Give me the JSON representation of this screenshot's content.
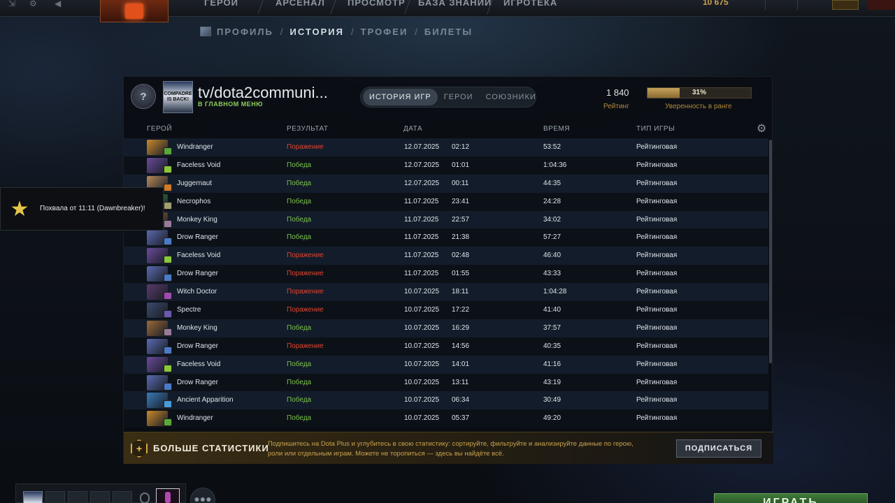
{
  "topbar": {
    "nav": [
      "ГЕРОИ",
      "АРСЕНАЛ",
      "ПРОСМОТР",
      "БАЗА ЗНАНИЙ",
      "ИГРОТЕКА"
    ],
    "currency": "10 675"
  },
  "subnav": {
    "items": [
      {
        "label": "ПРОФИЛЬ",
        "active": false
      },
      {
        "label": "ИСТОРИЯ",
        "active": true
      },
      {
        "label": "ТРОФЕИ",
        "active": false
      },
      {
        "label": "БИЛЕТЫ",
        "active": false
      }
    ]
  },
  "profile": {
    "avatar_text": "COMPADRE IS BACK!",
    "name": "tv/dota2communi...",
    "status": "В ГЛАВНОМ МЕНЮ",
    "tabs": [
      {
        "label": "ИСТОРИЯ ИГР",
        "active": true
      },
      {
        "label": "ГЕРОИ",
        "active": false
      },
      {
        "label": "СОЮЗНИКИ",
        "active": false
      }
    ],
    "rating_value": "1 840",
    "rating_label": "Рейтинг",
    "confidence_value": "31%",
    "confidence_fraction": 0.31,
    "confidence_label": "Уверенность в ранге"
  },
  "table": {
    "headers": {
      "hero": "ГЕРОЙ",
      "result": "РЕЗУЛЬТАТ",
      "date": "ДАТА",
      "duration": "ВРЕМЯ",
      "type": "ТИП ИГРЫ"
    },
    "rows": [
      {
        "hero": "Windranger",
        "result": "Поражение",
        "win": false,
        "date": "12.07.2025",
        "time": "02:12",
        "duration": "53:52",
        "type": "Рейтинговая",
        "color": "#c8892e",
        "badge": "#5aa83a"
      },
      {
        "hero": "Faceless Void",
        "result": "Победа",
        "win": true,
        "date": "12.07.2025",
        "time": "01:01",
        "duration": "1:04:36",
        "type": "Рейтинговая",
        "color": "#6a4a9a",
        "badge": "#8ac83a"
      },
      {
        "hero": "Juggernaut",
        "result": "Победа",
        "win": true,
        "date": "12.07.2025",
        "time": "00:11",
        "duration": "44:35",
        "type": "Рейтинговая",
        "color": "#b88a5a",
        "badge": "#d07a2a"
      },
      {
        "hero": "Necrophos",
        "result": "Победа",
        "win": true,
        "date": "11.07.2025",
        "time": "23:41",
        "duration": "24:28",
        "type": "Рейтинговая",
        "color": "#3a8a4a",
        "badge": "#a0a070"
      },
      {
        "hero": "Monkey King",
        "result": "Победа",
        "win": true,
        "date": "11.07.2025",
        "time": "22:57",
        "duration": "34:02",
        "type": "Рейтинговая",
        "color": "#9a6a3a",
        "badge": "#9a7a9a"
      },
      {
        "hero": "Drow Ranger",
        "result": "Победа",
        "win": true,
        "date": "11.07.2025",
        "time": "21:38",
        "duration": "57:27",
        "type": "Рейтинговая",
        "color": "#5a6ab0",
        "badge": "#4a7ac8"
      },
      {
        "hero": "Faceless Void",
        "result": "Поражение",
        "win": false,
        "date": "11.07.2025",
        "time": "02:48",
        "duration": "46:40",
        "type": "Рейтинговая",
        "color": "#6a4a9a",
        "badge": "#8ac83a"
      },
      {
        "hero": "Drow Ranger",
        "result": "Поражение",
        "win": false,
        "date": "11.07.2025",
        "time": "01:55",
        "duration": "43:33",
        "type": "Рейтинговая",
        "color": "#5a6ab0",
        "badge": "#4a7ac8"
      },
      {
        "hero": "Witch Doctor",
        "result": "Поражение",
        "win": false,
        "date": "10.07.2025",
        "time": "18:11",
        "duration": "1:04:28",
        "type": "Рейтинговая",
        "color": "#5a3a6a",
        "badge": "#a04ab0"
      },
      {
        "hero": "Spectre",
        "result": "Поражение",
        "win": false,
        "date": "10.07.2025",
        "time": "17:22",
        "duration": "41:40",
        "type": "Рейтинговая",
        "color": "#3a4a6a",
        "badge": "#6a5ab0"
      },
      {
        "hero": "Monkey King",
        "result": "Победа",
        "win": true,
        "date": "10.07.2025",
        "time": "16:29",
        "duration": "37:57",
        "type": "Рейтинговая",
        "color": "#9a6a3a",
        "badge": "#9a7a9a"
      },
      {
        "hero": "Drow Ranger",
        "result": "Поражение",
        "win": false,
        "date": "10.07.2025",
        "time": "14:56",
        "duration": "40:35",
        "type": "Рейтинговая",
        "color": "#5a6ab0",
        "badge": "#4a7ac8"
      },
      {
        "hero": "Faceless Void",
        "result": "Победа",
        "win": true,
        "date": "10.07.2025",
        "time": "14:01",
        "duration": "41:16",
        "type": "Рейтинговая",
        "color": "#6a4a9a",
        "badge": "#8ac83a"
      },
      {
        "hero": "Drow Ranger",
        "result": "Победа",
        "win": true,
        "date": "10.07.2025",
        "time": "13:11",
        "duration": "43:19",
        "type": "Рейтинговая",
        "color": "#5a6ab0",
        "badge": "#4a7ac8"
      },
      {
        "hero": "Ancient Apparition",
        "result": "Победа",
        "win": true,
        "date": "10.07.2025",
        "time": "06:34",
        "duration": "30:49",
        "type": "Рейтинговая",
        "color": "#3a7ab8",
        "badge": "#4a9ad8"
      },
      {
        "hero": "Windranger",
        "result": "Победа",
        "win": true,
        "date": "10.07.2025",
        "time": "05:37",
        "duration": "49:20",
        "type": "Рейтинговая",
        "color": "#c8892e",
        "badge": "#5aa83a"
      }
    ]
  },
  "plus_banner": {
    "title": "БОЛЬШЕ СТАТИСТИКИ",
    "description": "Подпишитесь на Dota Plus и углубитесь в свою статистику: сортируйте, фильтруйте и анализируйте данные по герою, роли или отдельным играм. Можете не торопиться — здесь вы найдёте всё.",
    "button": "ПОДПИСАТЬСЯ"
  },
  "toast": {
    "text": "Похвала от 11:11 (Dawnbreaker)!"
  },
  "bottom": {
    "play_label": "ИГРАТЬ"
  }
}
